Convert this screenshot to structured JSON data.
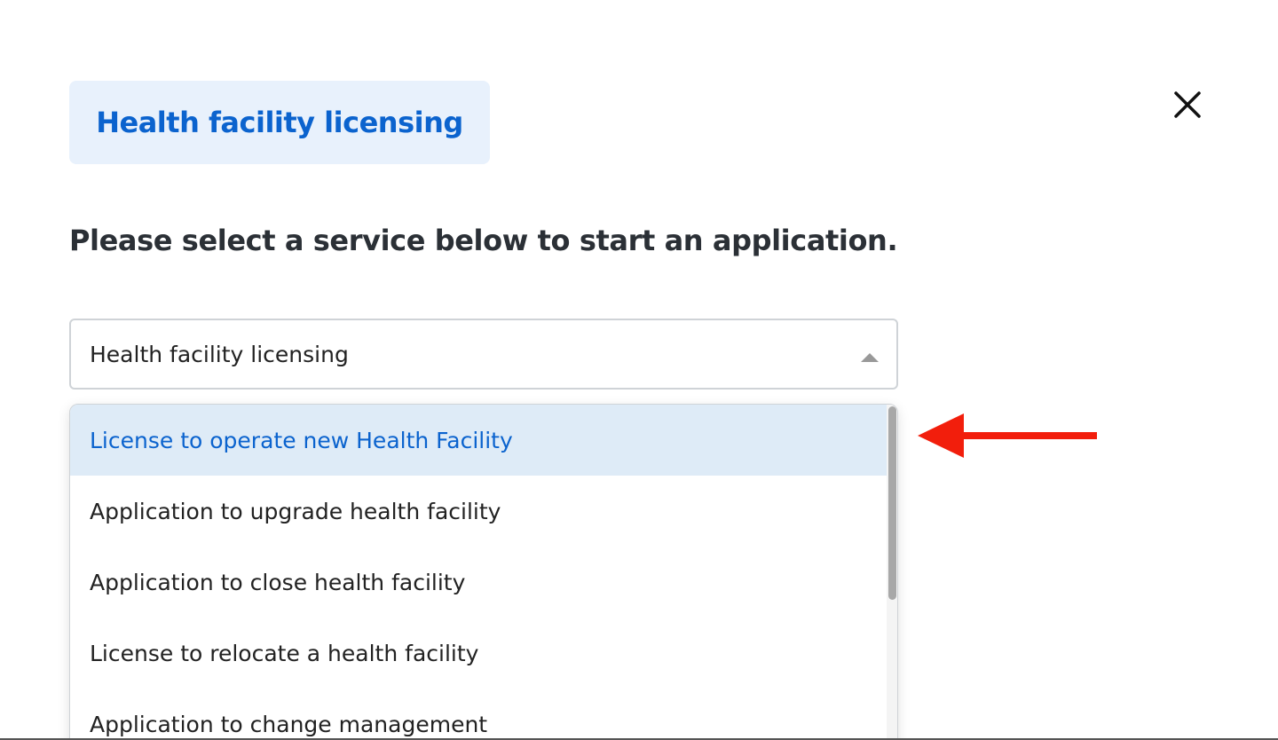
{
  "header": {
    "title": "Health facility licensing"
  },
  "prompt": {
    "text": "Please select a service below to start an application."
  },
  "select": {
    "value": "Health facility licensing",
    "options": [
      {
        "label": "License to operate new Health Facility",
        "active": true
      },
      {
        "label": "Application to upgrade health facility",
        "active": false
      },
      {
        "label": "Application to close health facility",
        "active": false
      },
      {
        "label": "License to relocate a health facility",
        "active": false
      },
      {
        "label": "Application to change management",
        "active": false
      }
    ]
  },
  "colors": {
    "accent": "#0b63ce",
    "chip_bg": "#e8f1fc",
    "active_option_bg": "#deebf7",
    "annotation_arrow": "#f21e0c"
  },
  "icons": {
    "close": "close-icon",
    "caret": "caret-up-icon",
    "annotation": "arrow-left-icon"
  }
}
